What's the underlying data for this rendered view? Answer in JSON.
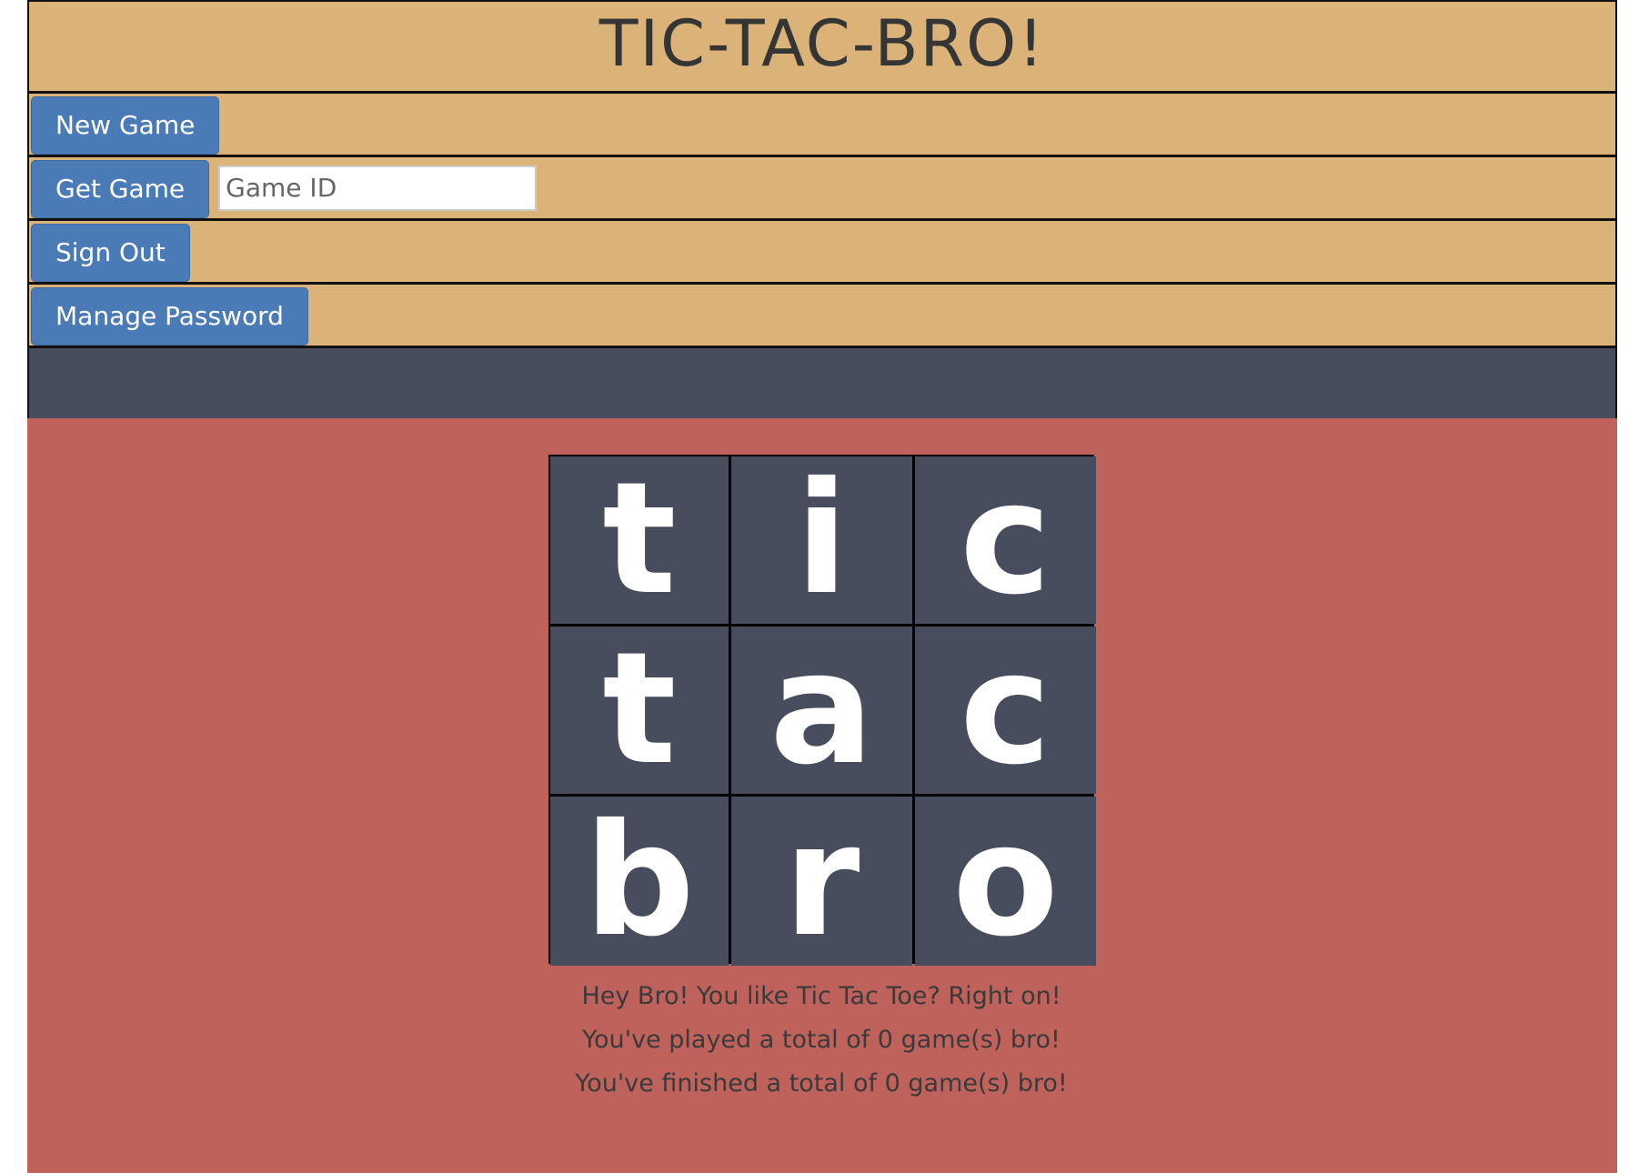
{
  "app": {
    "title": "TIC-TAC-BRO!"
  },
  "nav": {
    "new_game_label": "New Game",
    "get_game_label": "Get Game",
    "game_id_placeholder": "Game ID",
    "game_id_value": "",
    "sign_out_label": "Sign Out",
    "manage_password_label": "Manage Password"
  },
  "board": {
    "cells": [
      "t",
      "i",
      "c",
      "t",
      "a",
      "c",
      "b",
      "r",
      "o"
    ]
  },
  "messages": {
    "greeting": "Hey Bro! You like Tic Tac Toe? Right on!",
    "played": "You've played a total of 0 game(s) bro!",
    "finished": "You've finished a total of 0 game(s) bro!"
  },
  "colors": {
    "header_bg": "#dbb277",
    "button_bg": "#4a7bb6",
    "status_strip_bg": "#474d5c",
    "content_bg": "#bf625c",
    "cell_bg": "#474d5c"
  }
}
